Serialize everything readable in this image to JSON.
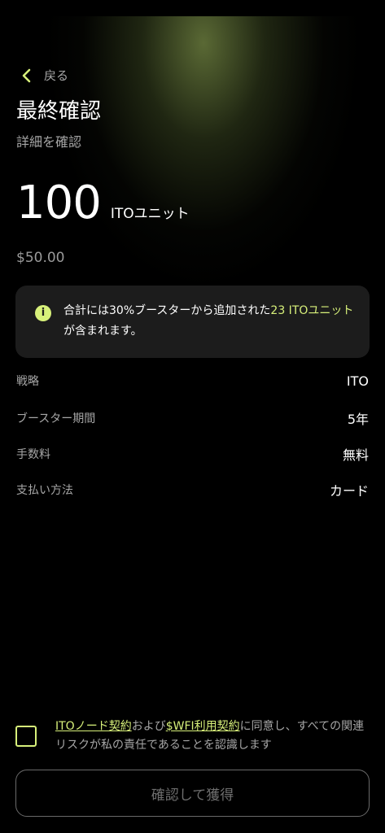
{
  "header": {
    "back_label": "戻る",
    "title": "最終確認",
    "subtitle": "詳細を確認"
  },
  "summary": {
    "amount": "100",
    "unit": "ITOユニット",
    "usd": "$50.00"
  },
  "info": {
    "text_before": "合計には30%ブースターから追加された",
    "highlight": "23 ITOユニット",
    "text_after": "が含まれます。"
  },
  "details": [
    {
      "label": "戦略",
      "value": "ITO"
    },
    {
      "label": "ブースター期間",
      "value": "5年"
    },
    {
      "label": "手数料",
      "value": "無料"
    },
    {
      "label": "支払い方法",
      "value": "カード"
    }
  ],
  "agreement": {
    "link1": "ITOノード契約",
    "text1": "および",
    "link2": "$WFI利用契約",
    "text2": "に同意し、すべての関連リスクが私の責任であることを認識します"
  },
  "button": {
    "confirm_label": "確認して獲得"
  },
  "colors": {
    "accent": "#d7f07a",
    "background": "#000000",
    "card": "#1c1c1c"
  }
}
